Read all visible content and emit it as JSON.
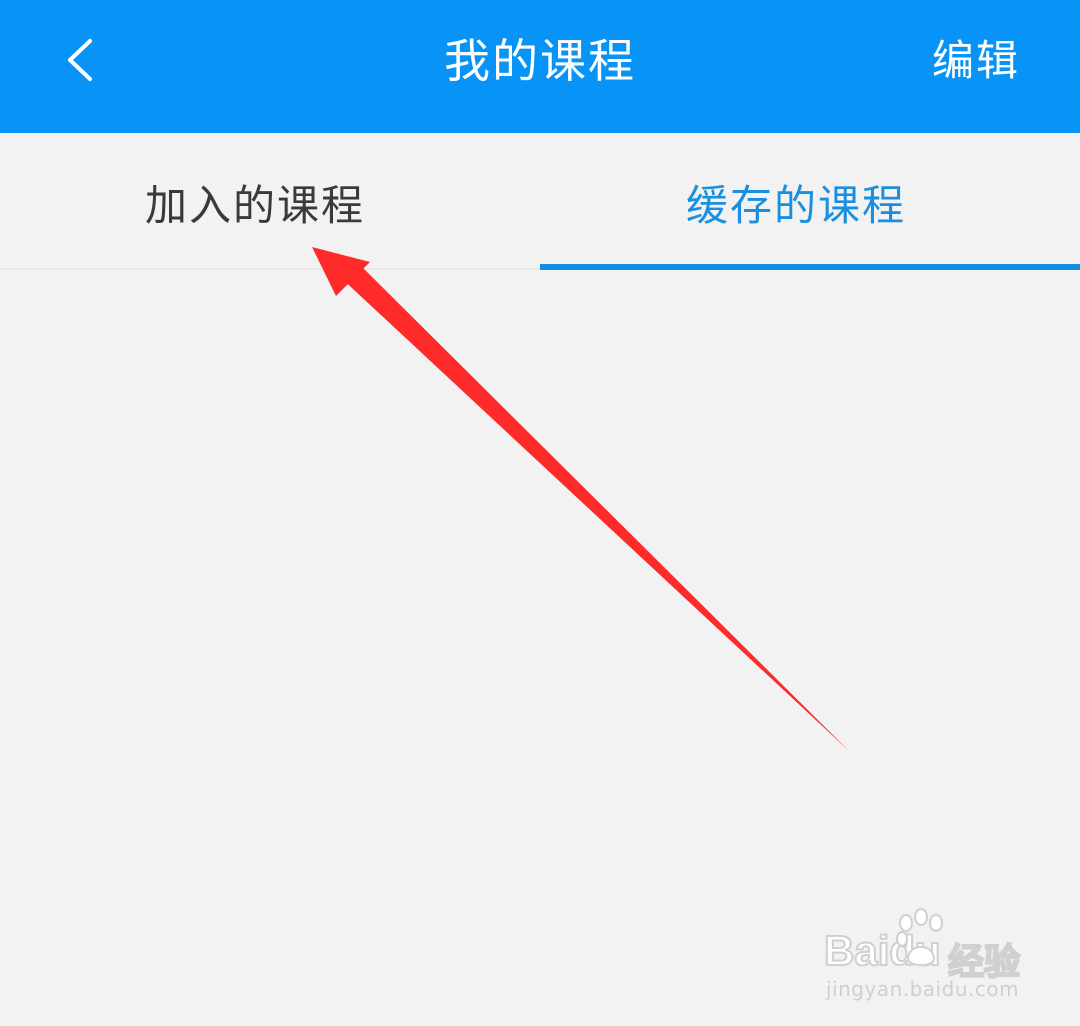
{
  "header": {
    "title": "我的课程",
    "edit_label": "编辑",
    "back_icon": "chevron-left-icon"
  },
  "tabs": [
    {
      "label": "加入的课程",
      "active": false
    },
    {
      "label": "缓存的课程",
      "active": true
    }
  ],
  "colors": {
    "header_bg": "#0894f6",
    "active_tab": "#1a8fe0",
    "inactive_tab": "#3a3a3a",
    "page_bg": "#f2f2f2",
    "annotation_arrow": "#ff2a2a"
  },
  "watermark": {
    "logo": "Baidu",
    "jingyan": "经验",
    "url": "jingyan.baidu.com"
  }
}
